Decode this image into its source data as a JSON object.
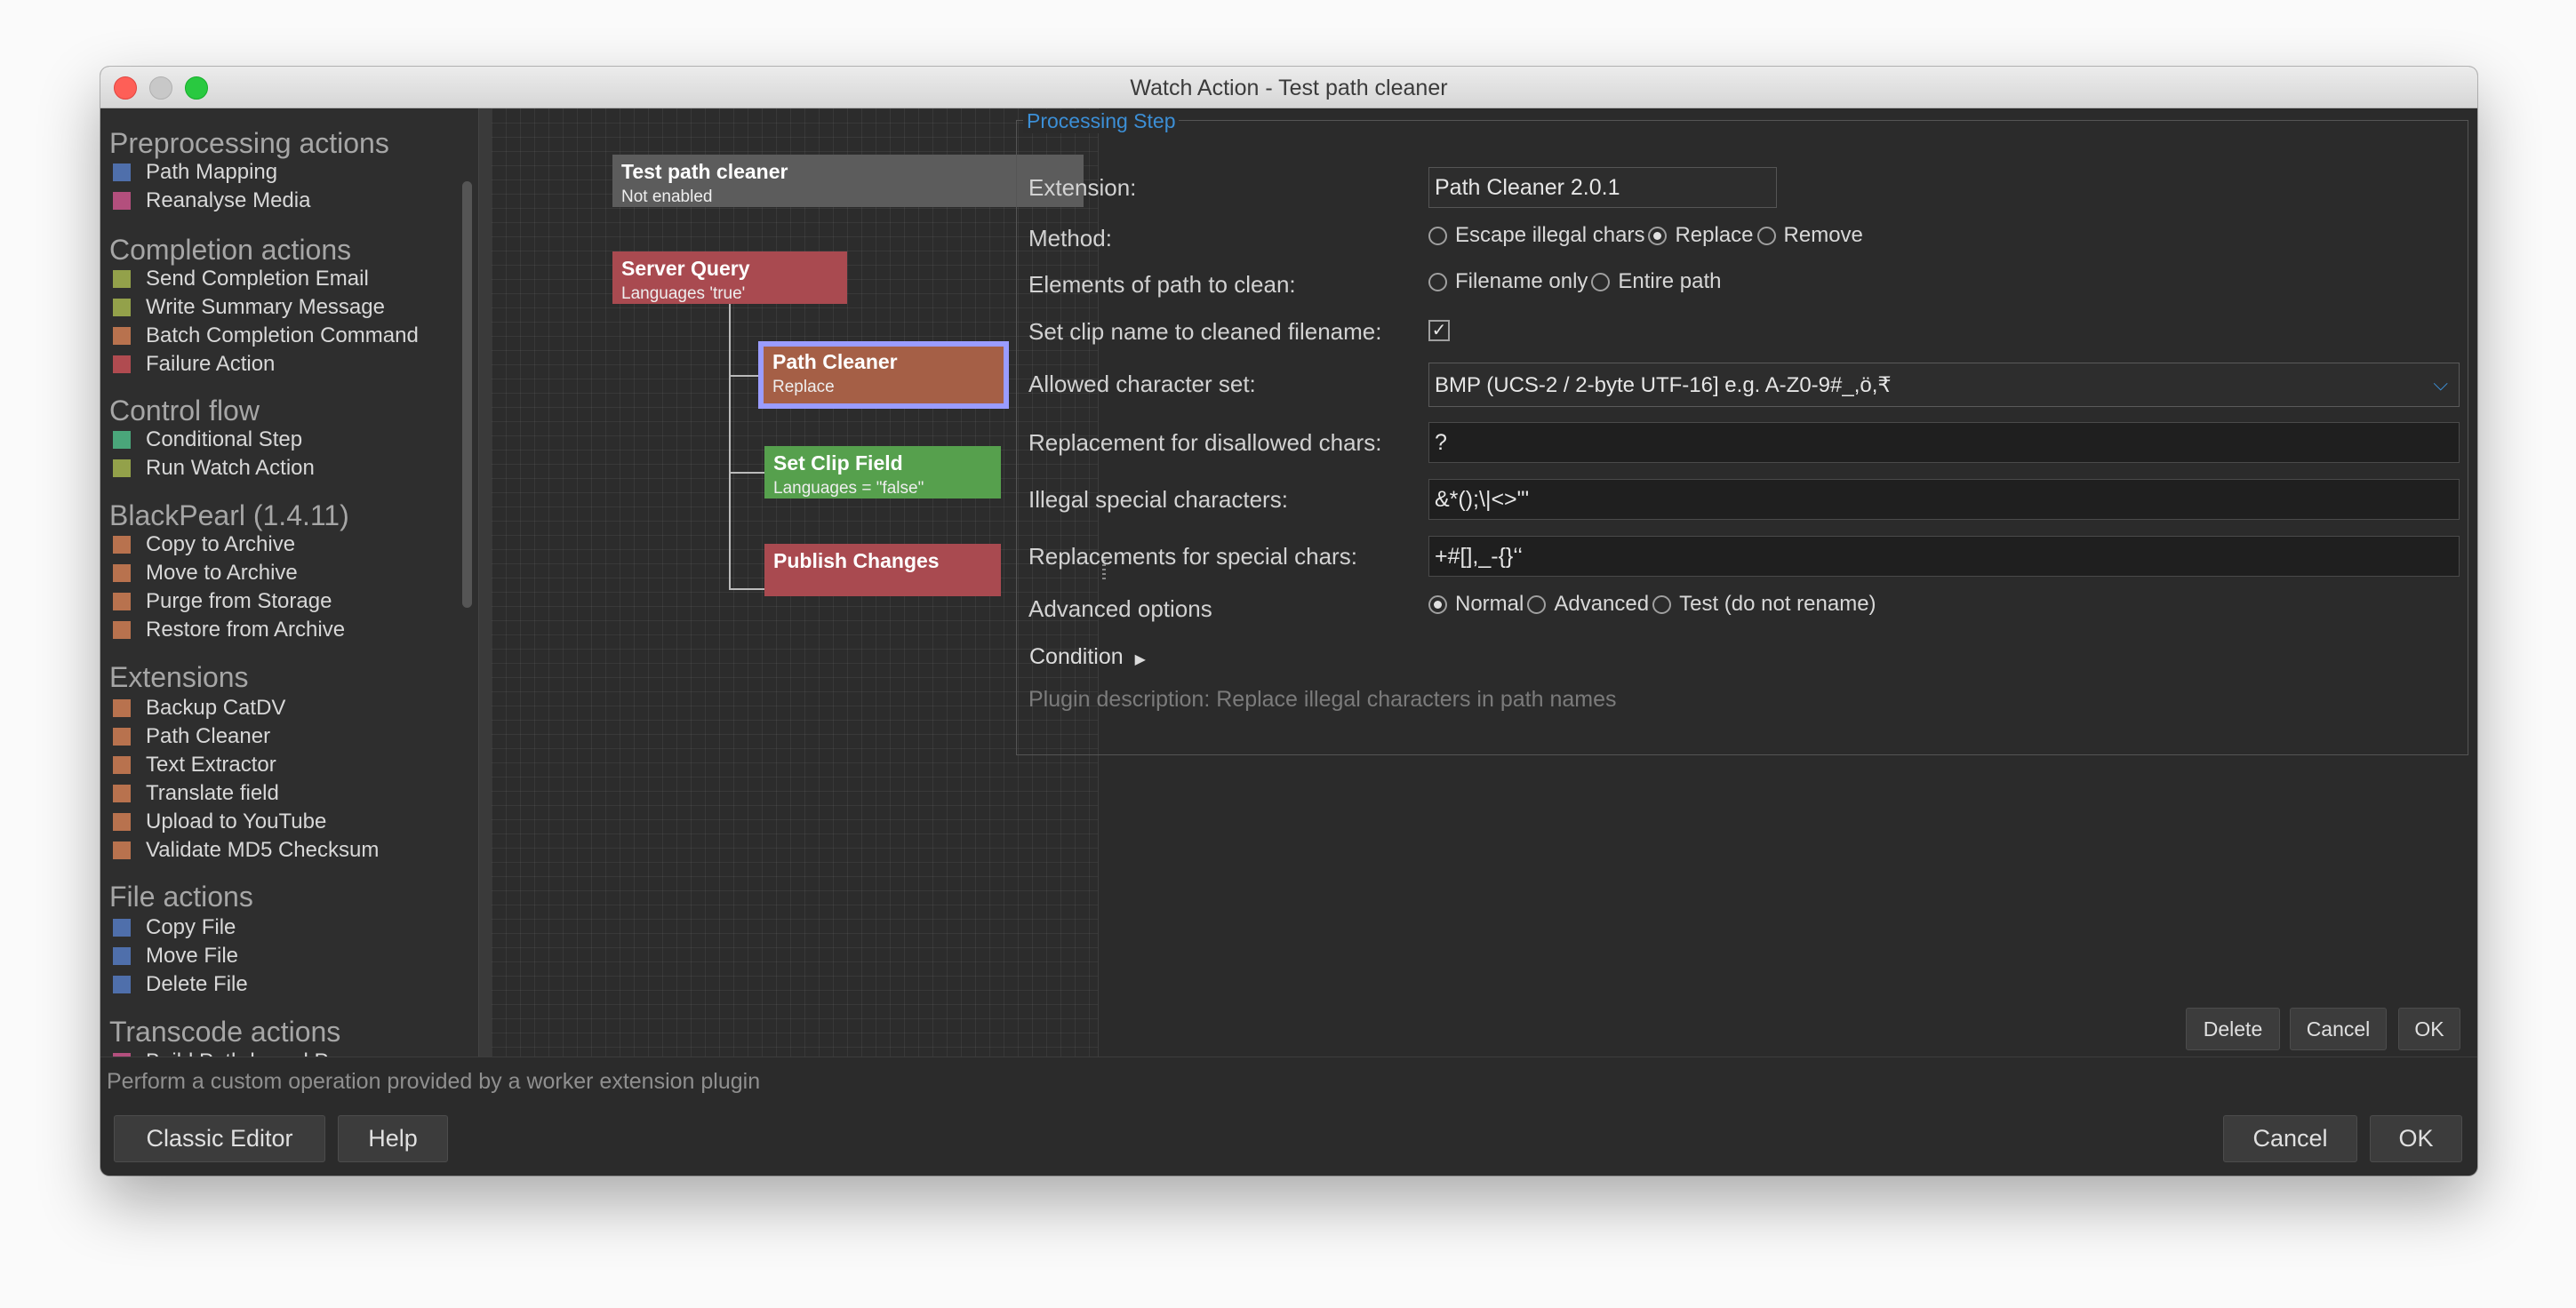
{
  "window": {
    "title": "Watch Action - Test path cleaner"
  },
  "sidebar": {
    "sections": [
      {
        "title": "Preprocessing actions",
        "items": [
          {
            "label": "Path Mapping",
            "color": "#4f6fab"
          },
          {
            "label": "Reanalyse Media",
            "color": "#b34f7d"
          }
        ]
      },
      {
        "title": "Completion actions",
        "items": [
          {
            "label": "Send Completion Email",
            "color": "#93a14a"
          },
          {
            "label": "Write Summary Message",
            "color": "#93a14a"
          },
          {
            "label": "Batch Completion Command",
            "color": "#b8724e"
          },
          {
            "label": "Failure Action",
            "color": "#b04b50"
          }
        ]
      },
      {
        "title": "Control flow",
        "items": [
          {
            "label": "Conditional Step",
            "color": "#4aa67a"
          },
          {
            "label": "Run Watch Action",
            "color": "#93a14a"
          }
        ]
      },
      {
        "title": "BlackPearl (1.4.11)",
        "items": [
          {
            "label": "Copy to Archive",
            "color": "#b8724e"
          },
          {
            "label": "Move to Archive",
            "color": "#b8724e"
          },
          {
            "label": "Purge from Storage",
            "color": "#b8724e"
          },
          {
            "label": "Restore from Archive",
            "color": "#b8724e"
          }
        ]
      },
      {
        "title": "Extensions",
        "items": [
          {
            "label": "Backup CatDV",
            "color": "#b8724e"
          },
          {
            "label": "Path Cleaner",
            "color": "#b8724e"
          },
          {
            "label": "Text Extractor",
            "color": "#b8724e"
          },
          {
            "label": "Translate field",
            "color": "#b8724e"
          },
          {
            "label": "Upload to YouTube",
            "color": "#b8724e"
          },
          {
            "label": "Validate MD5 Checksum",
            "color": "#b8724e"
          }
        ]
      },
      {
        "title": "File actions",
        "items": [
          {
            "label": "Copy File",
            "color": "#4f6fab"
          },
          {
            "label": "Move File",
            "color": "#4f6fab"
          },
          {
            "label": "Delete File",
            "color": "#4f6fab"
          }
        ]
      },
      {
        "title": "Transcode actions",
        "items": [
          {
            "label": "Build Path-based P...",
            "color": "#b34f7d"
          }
        ]
      }
    ]
  },
  "canvas": {
    "nodes": [
      {
        "title": "Test path cleaner",
        "subtitle": "Not enabled",
        "color": "#5c5c5c"
      },
      {
        "title": "Server Query",
        "subtitle": "Languages 'true'",
        "color": "#a94a50"
      },
      {
        "title": "Path Cleaner",
        "subtitle": "Replace",
        "color": "#a55f46",
        "selected_border": "#9a9cff"
      },
      {
        "title": "Set Clip Field",
        "subtitle": "Languages = \"false\"",
        "color": "#56a04d"
      },
      {
        "title": "Publish Changes",
        "subtitle": "",
        "color": "#a94a50"
      }
    ]
  },
  "form": {
    "legend": "Processing Step",
    "extension_label": "Extension:",
    "extension_value": "Path Cleaner 2.0.1",
    "method_label": "Method:",
    "method_options": [
      "Escape illegal chars",
      "Replace",
      "Remove"
    ],
    "method_selected": "Replace",
    "elements_label": "Elements of path to clean:",
    "elements_options": [
      "Filename only",
      "Entire path"
    ],
    "elements_selected": "",
    "set_clip_label": "Set clip name to cleaned filename:",
    "set_clip_checked": true,
    "charset_label": "Allowed character set:",
    "charset_value": "BMP (UCS-2 / 2-byte UTF-16]  e.g. A-Z0-9#_,ö,₹",
    "replacement_label": "Replacement for disallowed chars:",
    "replacement_value": "?",
    "illegal_label": "Illegal special characters:",
    "illegal_value": "&*();\\|<>\"'",
    "replacements_special_label": "Replacements for special chars:",
    "replacements_special_value": "+#[],_-{}‘‘",
    "advanced_label": "Advanced options",
    "advanced_options": [
      "Normal",
      "Advanced",
      "Test (do not rename)"
    ],
    "advanced_selected": "Normal",
    "condition_label": "Condition",
    "description": "Plugin description: Replace illegal characters in path names",
    "delete_button": "Delete",
    "cancel_button": "Cancel",
    "ok_button": "OK"
  },
  "footer": {
    "status": "Perform a custom operation provided by a worker extension plugin",
    "classic_editor": "Classic Editor",
    "help": "Help",
    "cancel": "Cancel",
    "ok": "OK"
  },
  "icons": {
    "window_close": "close-dot",
    "window_min": "minimize-dot",
    "window_max": "maximize-dot",
    "dropdown": "chevron-down-icon",
    "condition": "triangle-right-icon",
    "check": "checkmark-icon"
  }
}
